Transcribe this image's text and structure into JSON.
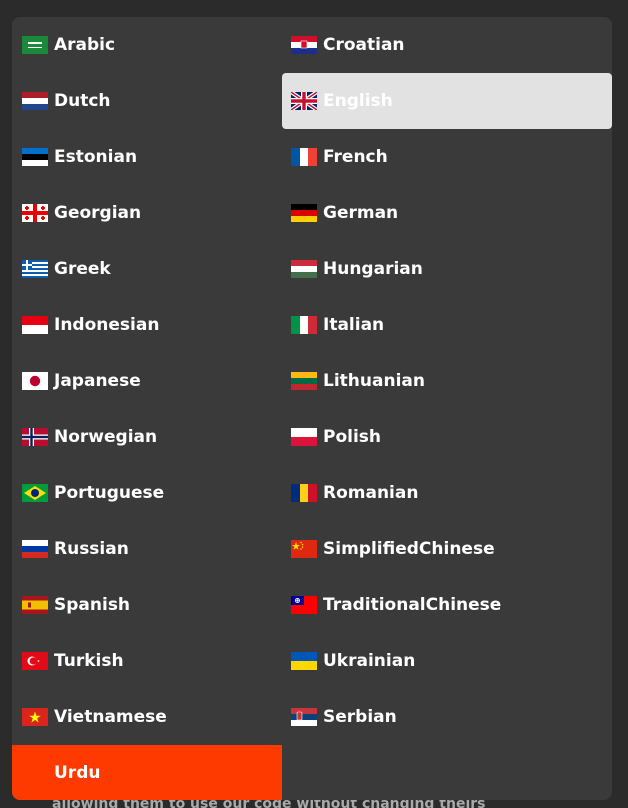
{
  "background_text": "allowing them to use our code without changing theirs",
  "languages": [
    {
      "label": "Arabic",
      "flag": "saudi-arabia-flag-icon"
    },
    {
      "label": "Croatian",
      "flag": "croatia-flag-icon"
    },
    {
      "label": "Dutch",
      "flag": "netherlands-flag-icon"
    },
    {
      "label": "English",
      "flag": "uk-flag-icon",
      "selected": true
    },
    {
      "label": "Estonian",
      "flag": "estonia-flag-icon"
    },
    {
      "label": "French",
      "flag": "france-flag-icon"
    },
    {
      "label": "Georgian",
      "flag": "georgia-flag-icon"
    },
    {
      "label": "German",
      "flag": "germany-flag-icon"
    },
    {
      "label": "Greek",
      "flag": "greece-flag-icon"
    },
    {
      "label": "Hungarian",
      "flag": "hungary-flag-icon"
    },
    {
      "label": "Indonesian",
      "flag": "indonesia-flag-icon"
    },
    {
      "label": "Italian",
      "flag": "italy-flag-icon"
    },
    {
      "label": "Japanese",
      "flag": "japan-flag-icon"
    },
    {
      "label": "Lithuanian",
      "flag": "lithuania-flag-icon"
    },
    {
      "label": "Norwegian",
      "flag": "norway-flag-icon"
    },
    {
      "label": "Polish",
      "flag": "poland-flag-icon"
    },
    {
      "label": "Portuguese",
      "flag": "brazil-flag-icon"
    },
    {
      "label": "Romanian",
      "flag": "romania-flag-icon"
    },
    {
      "label": "Russian",
      "flag": "russia-flag-icon"
    },
    {
      "label": "SimplifiedChinese",
      "flag": "china-flag-icon"
    },
    {
      "label": "Spanish",
      "flag": "spain-flag-icon"
    },
    {
      "label": "TraditionalChinese",
      "flag": "taiwan-flag-icon"
    },
    {
      "label": "Turkish",
      "flag": "turkey-flag-icon"
    },
    {
      "label": "Ukrainian",
      "flag": "ukraine-flag-icon"
    },
    {
      "label": "Vietnamese",
      "flag": "vietnam-flag-icon"
    },
    {
      "label": "Serbian",
      "flag": "serbia-flag-icon"
    },
    {
      "label": "Urdu",
      "flag": "",
      "highlighted": true
    }
  ],
  "colors": {
    "panel": "#3a3a3a",
    "selected": "#e2e2e2",
    "highlight": "#ff3a00"
  }
}
